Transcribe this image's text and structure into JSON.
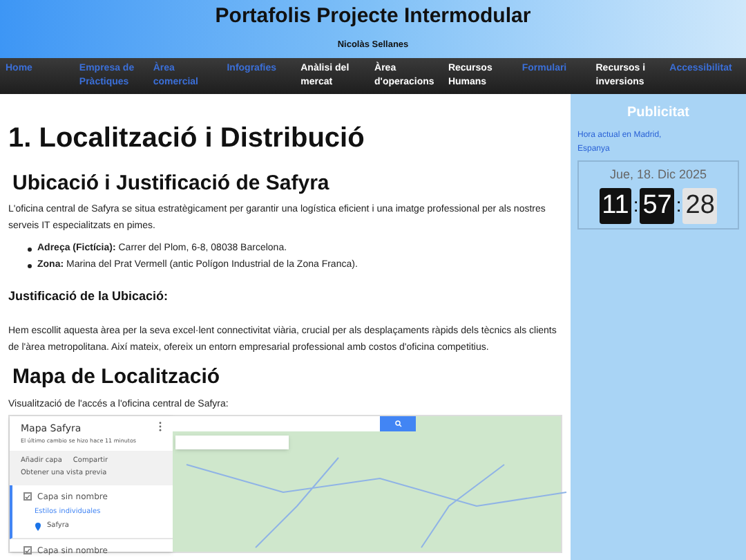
{
  "header": {
    "title": "Portafolis Projecte Intermodular",
    "author": "Nicolàs Sellanes"
  },
  "nav": [
    {
      "label": "Home",
      "color": "#3b6fd8"
    },
    {
      "label": "Empresa de Pràctiques",
      "color": "#3b6fd8"
    },
    {
      "label": "Àrea comercial",
      "color": "#3b6fd8"
    },
    {
      "label": "Infografies",
      "color": "#3b6fd8"
    },
    {
      "label": "Anàlisi del mercat",
      "color": "#ffffff"
    },
    {
      "label": "Àrea d'operacions",
      "color": "#ffffff"
    },
    {
      "label": "Recursos Humans",
      "color": "#ffffff"
    },
    {
      "label": "Formulari",
      "color": "#3b6fd8"
    },
    {
      "label": "Recursos i inversions",
      "color": "#ffffff"
    },
    {
      "label": "Accessibilitat",
      "color": "#3b6fd8"
    }
  ],
  "main": {
    "title": "1. Localització i Distribució",
    "section_title": "Ubicació i Justificació de Safyra",
    "intro": "L'oficina central de Safyra se situa estratègicament per garantir una logística eficient i una imatge professional per als nostres serveis IT especialitzats en pimes.",
    "bullets": [
      "**Adreça (Fictícia):** Carrer del Plom, 6-8, 08038 Barcelona.",
      "**Zona:** Marina del Prat Vermell (antic Polígon Industrial de la Zona Franca)."
    ],
    "justification_title": "Justificació de la Ubicació:",
    "justification": "Hem escollit aquesta àrea per la seva excel·lent connectivitat viària, crucial per als desplaçaments ràpids dels tècnics als clients de l'àrea metropolitana. Així mateix, ofereix un entorn empresarial professional amb costos d'oficina competitius.",
    "map_title": "Mapa de Localització",
    "map_caption": "Visualització de l'accés a l'oficina central de Safyra:"
  },
  "map_panel": {
    "title": "Mapa Safyra",
    "last_change": "El último cambio se hizo hace 11 minutos",
    "add_layer": "Añadir capa",
    "share": "Compartir",
    "preview": "Obtener una vista previa",
    "layers": [
      {
        "name": "Capa sin nombre",
        "checked": true,
        "style": "Estilos individuales",
        "place": "Safyra",
        "selected": true
      },
      {
        "name": "Capa sin nombre",
        "checked": true,
        "selected": false
      }
    ]
  },
  "sidebar": {
    "title": "Publicitat",
    "clock_label": "Hora actual en Madrid, Espanya",
    "date": "Jue, 18. Dic 2025",
    "hours": "11",
    "minutes": "57",
    "seconds": "28",
    "sep1": ":",
    "sep2": ":"
  }
}
